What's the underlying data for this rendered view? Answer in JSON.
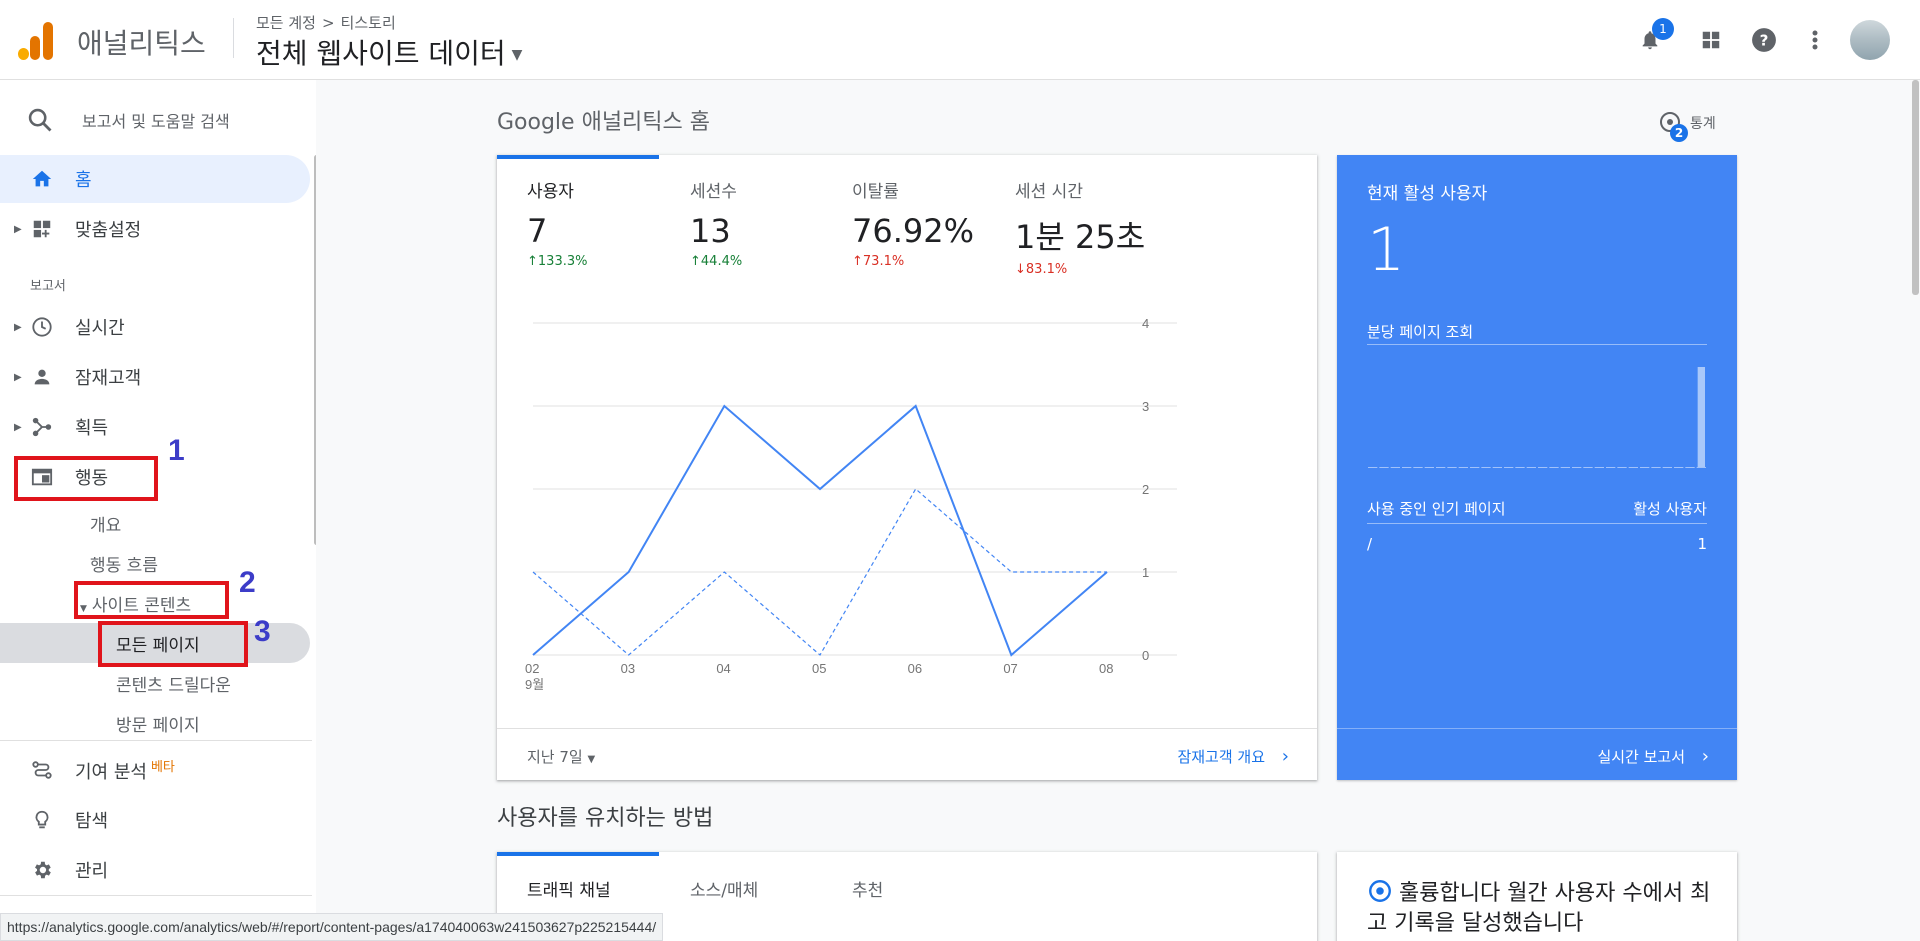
{
  "header": {
    "brand": "애널리틱스",
    "breadcrumb_account": "모든 계정",
    "breadcrumb_sep": ">",
    "breadcrumb_property": "티스토리",
    "view_title": "전체 웹사이트 데이터",
    "notification_count": "1",
    "logo_colors": [
      "#f9ab00",
      "#e37400",
      "#e37400"
    ]
  },
  "sidebar": {
    "search_text": "보고서 및 도움말 검색",
    "home": "홈",
    "customization": "맞춤설정",
    "reports_section": "보고서",
    "realtime": "실시간",
    "audience": "잠재고객",
    "acquisition": "획득",
    "behavior": "행동",
    "behavior_sub": {
      "overview": "개요",
      "flow": "행동 흐름",
      "site_content": "사이트 콘텐츠",
      "all_pages": "모든 페이지",
      "drilldown": "콘텐츠 드릴다운",
      "landing": "방문 페이지"
    },
    "attribution": "기여 분석",
    "beta": "베타",
    "discover": "탐색",
    "admin": "관리"
  },
  "annotations": [
    "1",
    "2",
    "3"
  ],
  "main": {
    "title": "Google 애널리틱스 홈",
    "insights_label": "통계",
    "insights_count": "2",
    "metrics": [
      {
        "label": "사용자",
        "value": "7",
        "delta": "133.3%",
        "direction": "up"
      },
      {
        "label": "세션수",
        "value": "13",
        "delta": "44.4%",
        "direction": "up"
      },
      {
        "label": "이탈률",
        "value": "76.92%",
        "delta": "73.1%",
        "direction": "up"
      },
      {
        "label": "세션 시간",
        "value": "1분 25초",
        "delta": "83.1%",
        "direction": "down"
      }
    ],
    "date_range": "지난 7일",
    "audience_link": "잠재고객 개요"
  },
  "chart_data": {
    "type": "line",
    "categories": [
      "02",
      "03",
      "04",
      "05",
      "06",
      "07",
      "08"
    ],
    "x_sublabel": "9월",
    "ylim": [
      0,
      4
    ],
    "y_ticks": [
      "0",
      "1",
      "2",
      "3",
      "4"
    ],
    "series": [
      {
        "values": [
          0,
          1,
          3,
          2,
          3,
          0,
          1
        ],
        "style": "solid",
        "color": "#4285f4"
      },
      {
        "values": [
          1,
          0,
          1,
          0,
          2,
          1,
          1
        ],
        "style": "dashed",
        "color": "#4285f4"
      }
    ]
  },
  "realtime": {
    "title": "현재 활성 사용자",
    "value": "1",
    "pageviews_label": "분당 페이지 조회",
    "pageviews_per_minute": [
      0,
      0,
      0,
      0,
      0,
      0,
      0,
      0,
      0,
      0,
      0,
      0,
      0,
      0,
      0,
      0,
      0,
      0,
      0,
      0,
      0,
      0,
      0,
      0,
      0,
      0,
      0,
      0,
      0,
      1
    ],
    "top_pages_header": "사용 중인 인기 페이지",
    "active_users_header": "활성 사용자",
    "top_page_path": "/",
    "top_page_users": "1",
    "link": "실시간 보고서"
  },
  "section2": {
    "title": "사용자를 유치하는 방법",
    "tabs": [
      "트래픽 채널",
      "소스/매체",
      "추천"
    ]
  },
  "note": {
    "text": "훌륭합니다 월간 사용자 수에서 최고 기록을 달성했습니다"
  },
  "status_url": "https://analytics.google.com/analytics/web/#/report/content-pages/a174040063w241503627p225215444/"
}
